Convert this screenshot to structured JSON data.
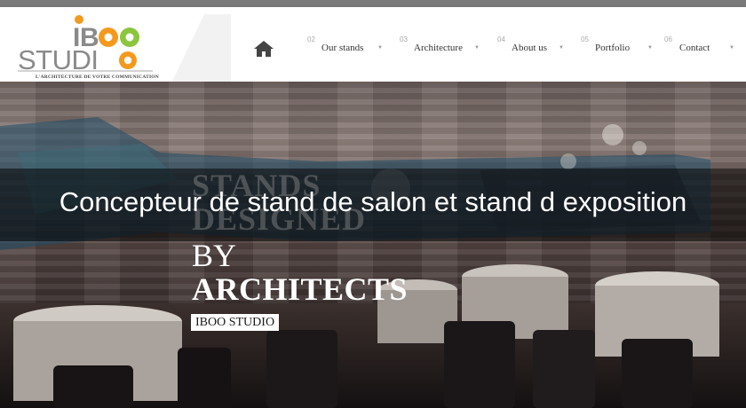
{
  "logo": {
    "brand_top": "IBOO",
    "brand_bottom": "STUDIO",
    "tagline": "L'ARCHITECTURE DE VOTRE COMMUNICATION"
  },
  "nav": {
    "home_icon": "home-icon",
    "items": [
      {
        "num": "02",
        "label": "Our stands"
      },
      {
        "num": "03",
        "label": "Architecture"
      },
      {
        "num": "04",
        "label": "About us"
      },
      {
        "num": "05",
        "label": "Portfolio"
      },
      {
        "num": "06",
        "label": "Contact"
      }
    ]
  },
  "hero": {
    "title": "Concepteur de stand de salon et stand d exposition",
    "line1": "STANDS",
    "line2": "DESIGNED",
    "line3": "BY",
    "line4": "ARCHITECTS",
    "badge": "IBOO STUDIO"
  },
  "colors": {
    "accent_green": "#8cc53e",
    "logo_orange": "#f39a1e",
    "logo_gray": "#8a8a8a"
  }
}
